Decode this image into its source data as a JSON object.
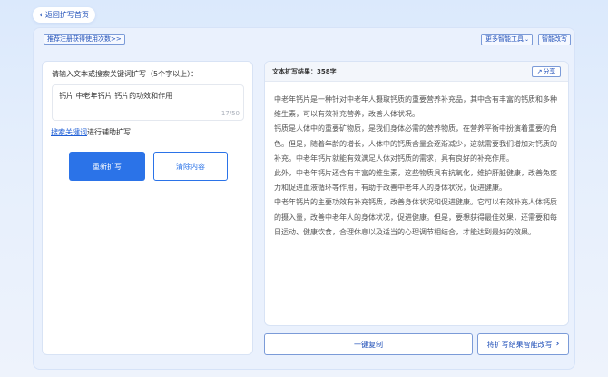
{
  "header": {
    "back_label": "返回扩写首页",
    "back_icon": "chevron-left-icon"
  },
  "toolbar": {
    "invite_link": "推荐注册获得使用次数>>",
    "more_tools": "更多智能工具",
    "more_tools_icon": "chevron-down-icon",
    "smart_rewrite": "智能改写"
  },
  "input_panel": {
    "prompt_label": "请输入文本或搜索关键词扩写（5个字以上）：",
    "input_value": "钙片 中老年钙片 钙片的功效和作用",
    "char_counter": "17/50",
    "assist_link": "搜索关键词",
    "assist_suffix": "进行辅助扩写",
    "regen_button": "重新扩写",
    "clear_button": "清除内容"
  },
  "result_panel": {
    "title": "文本扩写结果：358字",
    "share_label": "分享",
    "share_icon": "share-icon",
    "paragraphs": [
      "中老年钙片是一种针对中老年人摄取钙质的重要营养补充品，其中含有丰富的钙质和多种维生素，可以有效补充营养，改善人体状况。",
      "钙质是人体中的重要矿物质，是我们身体必需的营养物质，在营养平衡中扮演着重要的角色。但是，随着年龄的增长，人体中的钙质含量会逐渐减少，这就需要我们增加对钙质的补充。中老年钙片就能有效满足人体对钙质的需求，具有良好的补充作用。",
      "此外，中老年钙片还含有丰富的维生素，这些物质具有抗氧化，维护肝脏健康，改善免疫力和促进血液循环等作用，有助于改善中老年人的身体状况，促进健康。",
      "中老年钙片的主要功效有补充钙质，改善身体状况和促进健康。它可以有效补充人体钙质的摄入量，改善中老年人的身体状况，促进健康。但是，要想获得最佳效果，还需要和每日运动、健康饮食，合理休息以及适当的心理调节相结合，才能达到最好的效果。"
    ]
  },
  "actions": {
    "copy_button": "一键复制",
    "send_button": "将扩写结果智能改写",
    "send_icon": "chevron-right-icon"
  },
  "colors": {
    "accent": "#2b73e8",
    "link": "#1f4fb8",
    "background": "#dbe9fc"
  }
}
